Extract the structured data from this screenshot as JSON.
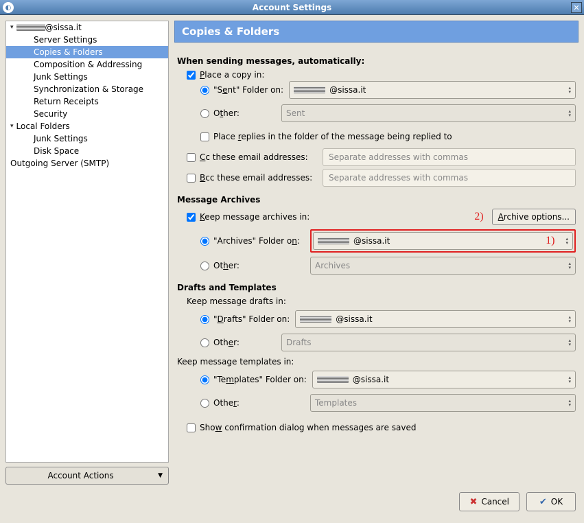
{
  "window": {
    "title": "Account Settings"
  },
  "sidebar": {
    "items": [
      {
        "label": "@sissa.it",
        "obscured": true,
        "level": 0,
        "expandable": true
      },
      {
        "label": "Server Settings",
        "level": 1
      },
      {
        "label": "Copies & Folders",
        "level": 1,
        "selected": true
      },
      {
        "label": "Composition & Addressing",
        "level": 1
      },
      {
        "label": "Junk Settings",
        "level": 1
      },
      {
        "label": "Synchronization & Storage",
        "level": 1
      },
      {
        "label": "Return Receipts",
        "level": 1
      },
      {
        "label": "Security",
        "level": 1
      },
      {
        "label": "Local Folders",
        "level": 0,
        "expandable": true
      },
      {
        "label": "Junk Settings",
        "level": 1
      },
      {
        "label": "Disk Space",
        "level": 1
      },
      {
        "label": "Outgoing Server (SMTP)",
        "level": 0
      }
    ],
    "account_actions_label": "Account Actions"
  },
  "panel": {
    "header": "Copies & Folders",
    "sending": {
      "title": "When sending messages, automatically:",
      "place_copy": "Place a copy in:",
      "sent_folder_on": "\"Sent\" Folder on:",
      "sent_account": "@sissa.it",
      "other": "Other:",
      "other_value": "Sent",
      "place_replies": "Place replies in the folder of the message being replied to",
      "cc_label": "Cc these email addresses:",
      "bcc_label": "Bcc these email addresses:",
      "addr_placeholder": "Separate addresses with commas"
    },
    "archives": {
      "title": "Message Archives",
      "keep": "Keep message archives in:",
      "archive_options": "Archive options...",
      "folder_on": "\"Archives\" Folder on:",
      "account": "@sissa.it",
      "other": "Other:",
      "other_value": "Archives",
      "annot1": "1)",
      "annot2": "2)"
    },
    "drafts": {
      "title": "Drafts and Templates",
      "keep_drafts": "Keep message drafts in:",
      "drafts_folder_on": "\"Drafts\" Folder on:",
      "drafts_account": "@sissa.it",
      "other": "Other:",
      "drafts_other_value": "Drafts",
      "keep_templates": "Keep message templates in:",
      "templates_folder_on": "\"Templates\" Folder on:",
      "templates_account": "@sissa.it",
      "templates_other_value": "Templates",
      "show_confirm": "Show confirmation dialog when messages are saved"
    }
  },
  "footer": {
    "cancel": "Cancel",
    "ok": "OK"
  }
}
